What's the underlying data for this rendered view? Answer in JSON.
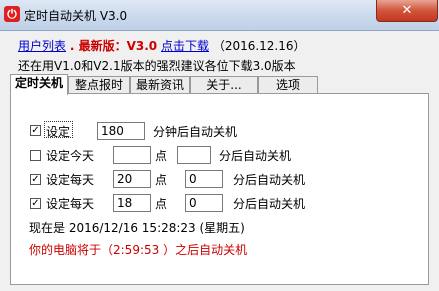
{
  "window": {
    "title": "定时自动关机 V3.0",
    "close_glyph": "✕",
    "icon_glyph": "⏻"
  },
  "header": {
    "user_list": "用户列表",
    "latest_prefix": ". 最新版：V3.0",
    "download": "点击下载",
    "date": "（2016.12.16）",
    "notice": "还在用V1.0和V2.1版本的强烈建议各位下载3.0版本"
  },
  "tabs": [
    "定时关机",
    "整点报时",
    "最新资讯",
    "关于...",
    "选项"
  ],
  "rows": [
    {
      "checked": true,
      "label": "设定",
      "minutes": "180",
      "suffix": "分钟后自动关机"
    },
    {
      "checked": false,
      "label": "设定今天",
      "hour": "",
      "hour_unit": "点",
      "minute": "",
      "suffix": "分后自动关机"
    },
    {
      "checked": true,
      "label": "设定每天",
      "hour": "20",
      "hour_unit": "点",
      "minute": "0",
      "suffix": "分后自动关机"
    },
    {
      "checked": true,
      "label": "设定每天",
      "hour": "18",
      "hour_unit": "点",
      "minute": "0",
      "suffix": "分后自动关机"
    }
  ],
  "status": {
    "now": "现在是 2016/12/16 15:28:23 (星期五)",
    "countdown": "你的电脑将于（2:59:53 ）之后自动关机"
  },
  "check_glyph": "✓"
}
